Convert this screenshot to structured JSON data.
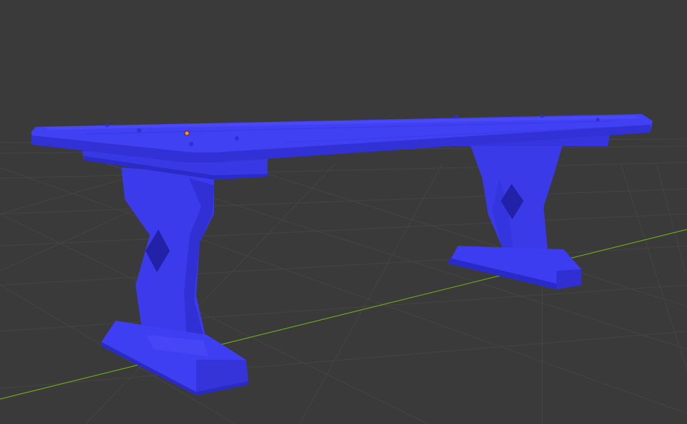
{
  "viewport": {
    "background": "#3a3a3a",
    "grid_color": "#444444",
    "x_axis_color": "#a0a0a0",
    "y_axis_color": "#6aa61c"
  },
  "model": {
    "name": "table",
    "color": "#3e3ef2",
    "shade_color": "#2c2ccf",
    "highlight_color": "#5a5aff"
  },
  "origin_marker": {
    "icon": "origin-dot-icon",
    "color": "#ff8a2a"
  }
}
